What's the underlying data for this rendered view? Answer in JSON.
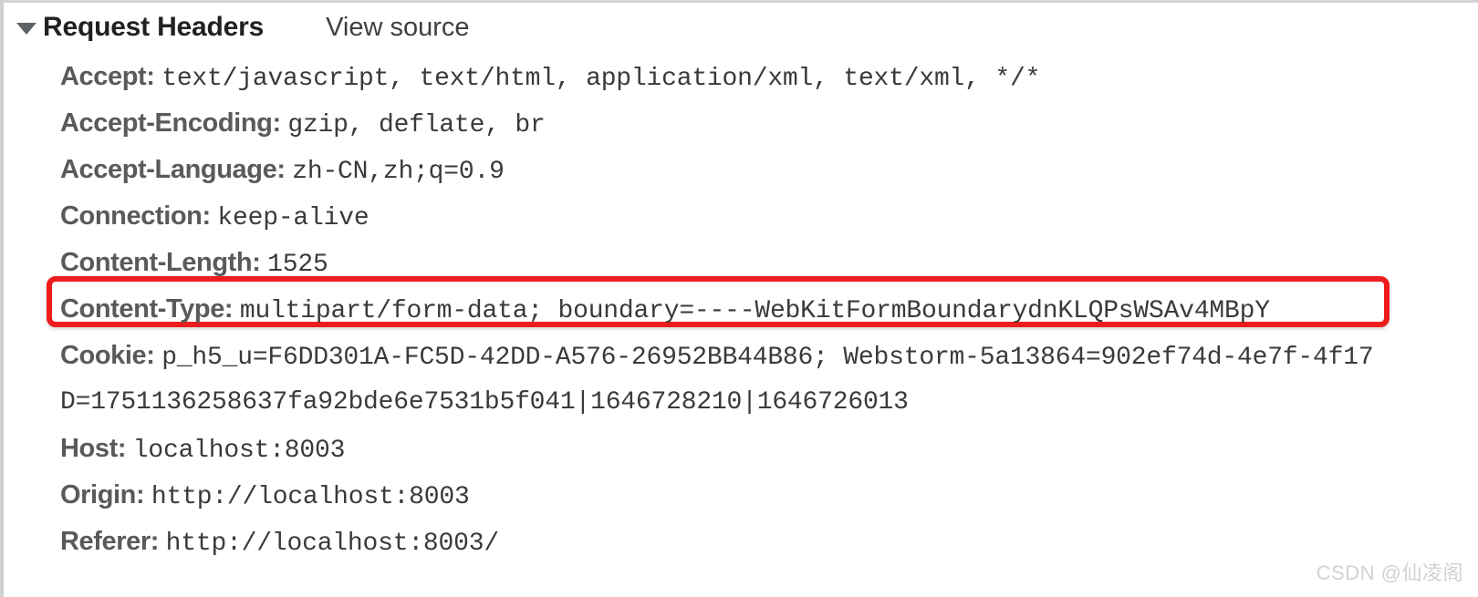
{
  "panel": {
    "section_title": "Request Headers",
    "view_source_label": "View source",
    "disclosure_state": "expanded",
    "accent_color": "#ee1c1c",
    "header_name_color": "#5a5a5a",
    "header_value_color": "#3a3a3a"
  },
  "headers": [
    {
      "name": "Accept:",
      "value": "text/javascript, text/html, application/xml, text/xml, */*",
      "highlighted": false
    },
    {
      "name": "Accept-Encoding:",
      "value": "gzip, deflate, br",
      "highlighted": false
    },
    {
      "name": "Accept-Language:",
      "value": "zh-CN,zh;q=0.9",
      "highlighted": false
    },
    {
      "name": "Connection:",
      "value": "keep-alive",
      "highlighted": false
    },
    {
      "name": "Content-Length:",
      "value": "1525",
      "highlighted": false
    },
    {
      "name": "Content-Type:",
      "value": "multipart/form-data; boundary=----WebKitFormBoundarydnKLQPsWSAv4MBpY",
      "highlighted": true
    },
    {
      "name": "Cookie:",
      "value": "p_h5_u=F6DD301A-FC5D-42DD-A576-26952BB44B86; Webstorm-5a13864=902ef74d-4e7f-4f17",
      "continuation": "D=1751136258637fa92bde6e7531b5f041|1646728210|1646726013",
      "highlighted": false
    },
    {
      "name": "Host:",
      "value": "localhost:8003",
      "highlighted": false
    },
    {
      "name": "Origin:",
      "value": "http://localhost:8003",
      "highlighted": false
    },
    {
      "name": "Referer:",
      "value": "http://localhost:8003/",
      "highlighted": false
    }
  ],
  "watermark": {
    "text": "CSDN @仙凌阁"
  }
}
